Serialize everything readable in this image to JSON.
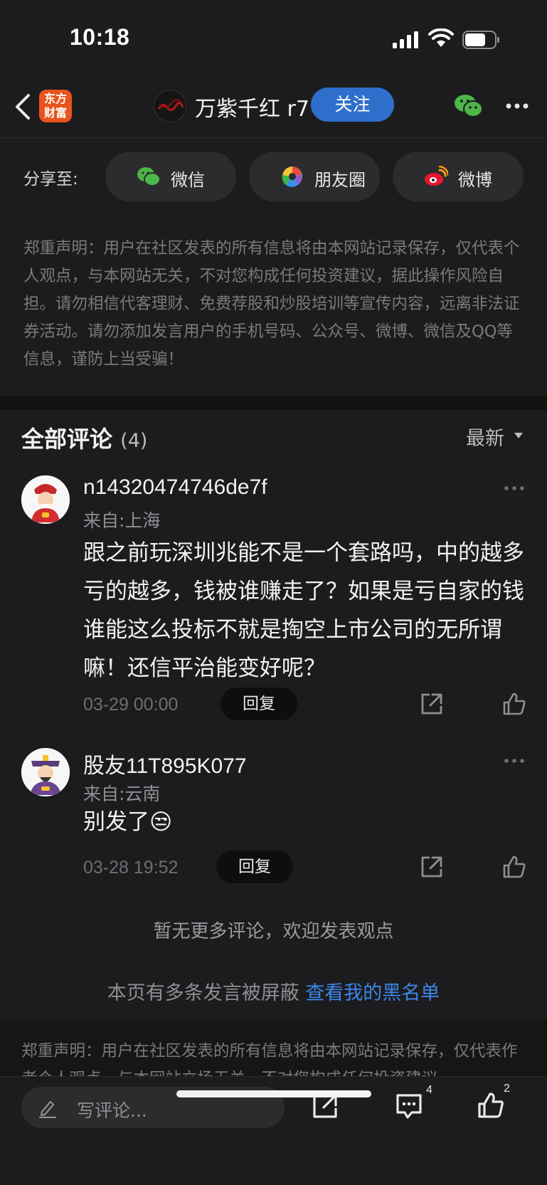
{
  "status_bar": {
    "time": "10:18"
  },
  "nav": {
    "app_logo_text": "东方财富",
    "author_name": "万紫千红 r7",
    "follow_label": "关注"
  },
  "share": {
    "label": "分享至:",
    "targets": [
      "微信",
      "朋友圈",
      "微博"
    ]
  },
  "disclaimer": "郑重声明：用户在社区发表的所有信息将由本网站记录保存，仅代表个人观点，与本网站无关，不对您构成任何投资建议，据此操作风险自担。请勿相信代客理财、免费荐股和炒股培训等宣传内容，远离非法证券活动。请勿添加发言用户的手机号码、公众号、微博、微信及QQ等信息，谨防上当受骗！",
  "comments_section": {
    "title": "全部评论",
    "count": "(4)",
    "sort_label": "最新"
  },
  "comments": [
    {
      "user": "n14320474746de7f",
      "location": "来自:上海",
      "text": "跟之前玩深圳兆能不是一个套路吗，中的越多亏的越多，钱被谁赚走了？如果是亏自家的钱谁能这么投标不就是掏空上市公司的无所谓嘛！还信平治能变好呢？",
      "time": "03-29 00:00",
      "reply_label": "回复"
    },
    {
      "user": "股友11T895K077",
      "location": "来自:云南",
      "text": "别发了😒",
      "time": "03-28 19:52",
      "reply_label": "回复"
    }
  ],
  "no_more": "暂无更多评论，欢迎发表观点",
  "blocked": {
    "text": "本页有多条发言被屏蔽 ",
    "link": "查看我的黑名单"
  },
  "bottom_disclaimer": "郑重声明：用户在社区发表的所有信息将由本网站记录保存，仅代表作者个人观点，与本网站立场无关，不对您构成任何投资建议。",
  "toolbar": {
    "input_placeholder": "写评论...",
    "comment_count": "4",
    "like_count": "2"
  }
}
